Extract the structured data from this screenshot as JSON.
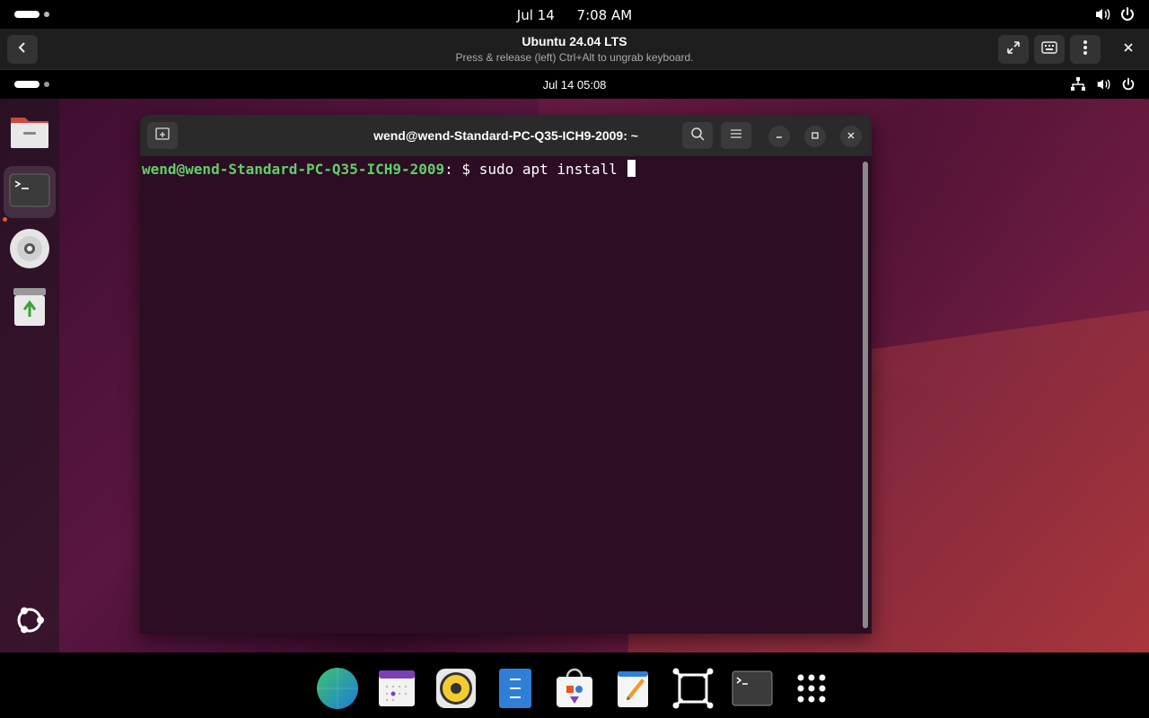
{
  "host_topbar": {
    "date": "Jul 14",
    "time": "7:08 AM",
    "icons": [
      "volume-icon",
      "power-icon"
    ]
  },
  "viewer": {
    "title": "Ubuntu 24.04 LTS",
    "subtitle": "Press & release (left) Ctrl+Alt to ungrab keyboard.",
    "buttons": [
      "back-icon",
      "fullscreen-icon",
      "keyboard-icon",
      "menu-icon",
      "close-icon"
    ]
  },
  "guest_topbar": {
    "clock": "Jul 14  05:08",
    "icons": [
      "network-icon",
      "volume-icon",
      "power-icon"
    ]
  },
  "dock": {
    "items": [
      "files",
      "terminal",
      "cd-drive",
      "trash",
      "ubuntu-logo"
    ]
  },
  "terminal": {
    "title": "wend@wend-Standard-PC-Q35-ICH9-2009: ~",
    "prompt_user": "wend@wend-Standard-PC-Q35-ICH9-2009",
    "prompt_suffix": ": $ ",
    "command": "sudo apt install "
  },
  "taskbar": {
    "items": [
      "browser",
      "calendar",
      "music",
      "file-manager",
      "software-store",
      "text-editor",
      "virtual-machine-manager",
      "terminal",
      "app-grid"
    ]
  },
  "colors": {
    "accent": "#e95420",
    "terminal_bg": "#2c0d23",
    "prompt_user": "#5fd068"
  }
}
